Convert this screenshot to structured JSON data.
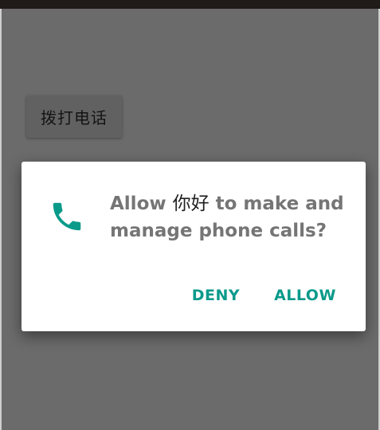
{
  "status_bar": {},
  "background_button": {
    "label": "拨打电话"
  },
  "permission_dialog": {
    "icon": "phone-icon",
    "message_prefix": "Allow ",
    "app_name": "你好",
    "message_suffix": " to make and manage phone calls?",
    "deny_label": "DENY",
    "allow_label": "ALLOW"
  },
  "colors": {
    "accent": "#0a9a8a",
    "scrim": "#6b6b6b",
    "dialog_bg": "#ffffff",
    "message_text": "#757575"
  }
}
